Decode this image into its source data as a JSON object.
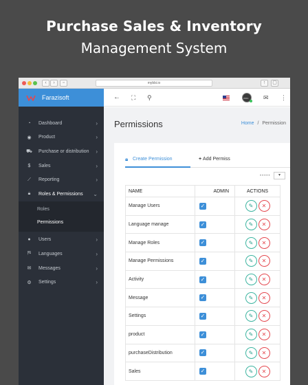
{
  "promo": {
    "title": "Purchase Sales & Inventory",
    "subtitle": "Management System"
  },
  "browser": {
    "url": "mybbi.io"
  },
  "sidebar": {
    "brand": "Farazisoft",
    "items": [
      {
        "label": "Dashboard",
        "icon": "dashboard-icon"
      },
      {
        "label": "Product",
        "icon": "product-icon"
      },
      {
        "label": "Purchase or distribution",
        "icon": "cart-icon"
      },
      {
        "label": "Sales",
        "icon": "dollar-icon"
      },
      {
        "label": "Reporting",
        "icon": "chart-icon"
      },
      {
        "label": "Roles & Permissions",
        "icon": "lock-icon"
      },
      {
        "label": "Users",
        "icon": "user-icon"
      },
      {
        "label": "Languages",
        "icon": "language-icon"
      },
      {
        "label": "Messages",
        "icon": "envelope-icon"
      },
      {
        "label": "Settings",
        "icon": "gear-icon"
      }
    ],
    "submenu": [
      "Roles",
      "Permissions"
    ]
  },
  "topbar": {
    "icons": [
      "back-arrow-icon",
      "fullscreen-icon",
      "search-icon",
      "flag-icon",
      "avatar",
      "mail-icon",
      "more-icon"
    ],
    "avatar_text": "ORIA"
  },
  "page": {
    "title": "Permissions",
    "breadcrumb_home": "Home",
    "breadcrumb_sep": "/",
    "breadcrumb_current": "Permission"
  },
  "tabs": {
    "create": "Create Permission",
    "add": "Add Permiss"
  },
  "table": {
    "headers": {
      "name": "NAME",
      "admin": "ADMIN",
      "actions": "ACTIONS"
    },
    "rows": [
      {
        "name": "Manage Users",
        "admin": true
      },
      {
        "name": "Language manage",
        "admin": true
      },
      {
        "name": "Manage Roles",
        "admin": true
      },
      {
        "name": "Manage Permissions",
        "admin": true
      },
      {
        "name": "Activity",
        "admin": true
      },
      {
        "name": "Message",
        "admin": true
      },
      {
        "name": "Settings",
        "admin": true
      },
      {
        "name": "product",
        "admin": true
      },
      {
        "name": "purchaseDistribution",
        "admin": true
      },
      {
        "name": "Sales",
        "admin": true
      }
    ]
  },
  "colors": {
    "accent": "#3d8fd8",
    "sidebar": "#2b3039",
    "edit": "#2aa08e",
    "delete": "#e4484f"
  }
}
